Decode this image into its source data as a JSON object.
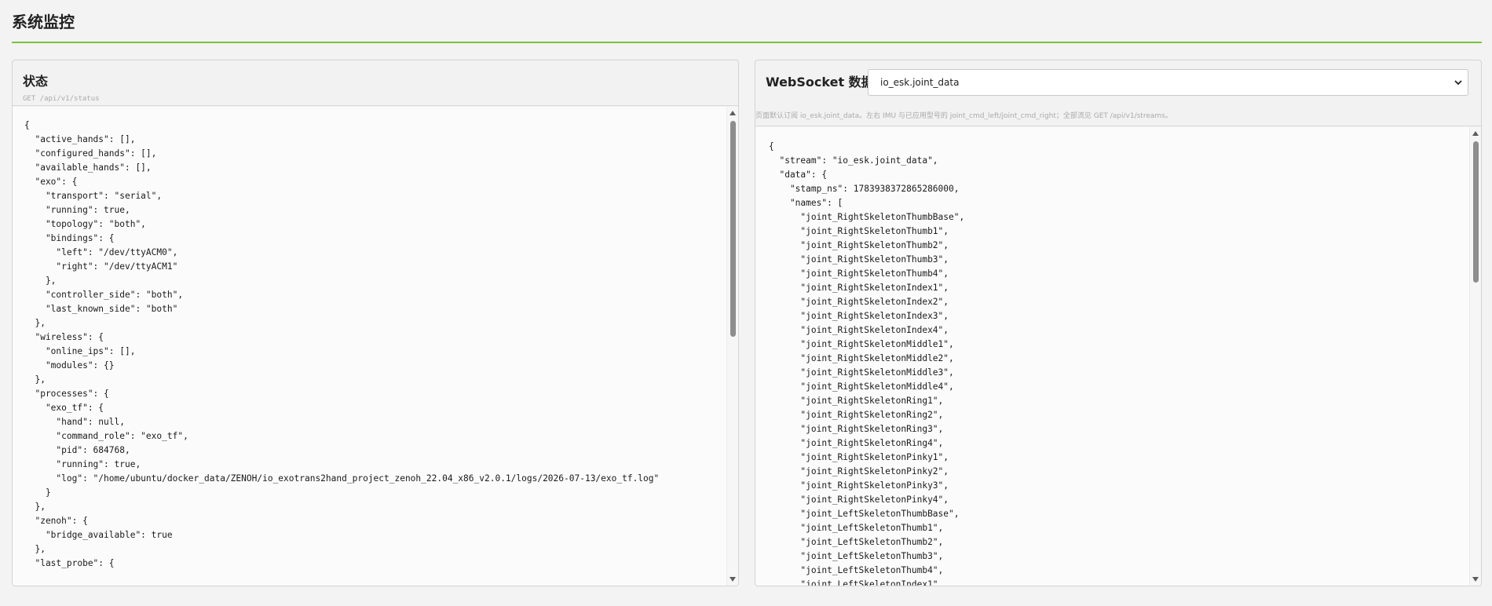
{
  "page": {
    "title": "系统监控"
  },
  "status_panel": {
    "title": "状态",
    "endpoint": "GET /api/v1/status",
    "code": "{\n  \"active_hands\": [],\n  \"configured_hands\": [],\n  \"available_hands\": [],\n  \"exo\": {\n    \"transport\": \"serial\",\n    \"running\": true,\n    \"topology\": \"both\",\n    \"bindings\": {\n      \"left\": \"/dev/ttyACM0\",\n      \"right\": \"/dev/ttyACM1\"\n    },\n    \"controller_side\": \"both\",\n    \"last_known_side\": \"both\"\n  },\n  \"wireless\": {\n    \"online_ips\": [],\n    \"modules\": {}\n  },\n  \"processes\": {\n    \"exo_tf\": {\n      \"hand\": null,\n      \"command_role\": \"exo_tf\",\n      \"pid\": 684768,\n      \"running\": true,\n      \"log\": \"/home/ubuntu/docker_data/ZENOH/io_exotrans2hand_project_zenoh_22.04_x86_v2.0.1/logs/2026-07-13/exo_tf.log\"\n    }\n  },\n  \"zenoh\": {\n    \"bridge_available\": true\n  },\n  \"last_probe\": {"
  },
  "ws_panel": {
    "title": "WebSocket 数据",
    "selected_stream": "io_esk.joint_data",
    "hint": "页面默认订阅 io_esk.joint_data。左右 IMU 与已应用型号的 joint_cmd_left/joint_cmd_right；全部流见 GET /api/v1/streams。",
    "code": "{\n  \"stream\": \"io_esk.joint_data\",\n  \"data\": {\n    \"stamp_ns\": 1783938372865286000,\n    \"names\": [\n      \"joint_RightSkeletonThumbBase\",\n      \"joint_RightSkeletonThumb1\",\n      \"joint_RightSkeletonThumb2\",\n      \"joint_RightSkeletonThumb3\",\n      \"joint_RightSkeletonThumb4\",\n      \"joint_RightSkeletonIndex1\",\n      \"joint_RightSkeletonIndex2\",\n      \"joint_RightSkeletonIndex3\",\n      \"joint_RightSkeletonIndex4\",\n      \"joint_RightSkeletonMiddle1\",\n      \"joint_RightSkeletonMiddle2\",\n      \"joint_RightSkeletonMiddle3\",\n      \"joint_RightSkeletonMiddle4\",\n      \"joint_RightSkeletonRing1\",\n      \"joint_RightSkeletonRing2\",\n      \"joint_RightSkeletonRing3\",\n      \"joint_RightSkeletonRing4\",\n      \"joint_RightSkeletonPinky1\",\n      \"joint_RightSkeletonPinky2\",\n      \"joint_RightSkeletonPinky3\",\n      \"joint_RightSkeletonPinky4\",\n      \"joint_LeftSkeletonThumbBase\",\n      \"joint_LeftSkeletonThumb1\",\n      \"joint_LeftSkeletonThumb2\",\n      \"joint_LeftSkeletonThumb3\",\n      \"joint_LeftSkeletonThumb4\",\n      \"joint_LeftSkeletonIndex1\","
  },
  "colors": {
    "accent": "#7cc242"
  },
  "icons": {
    "select": "chevron-down-icon"
  }
}
